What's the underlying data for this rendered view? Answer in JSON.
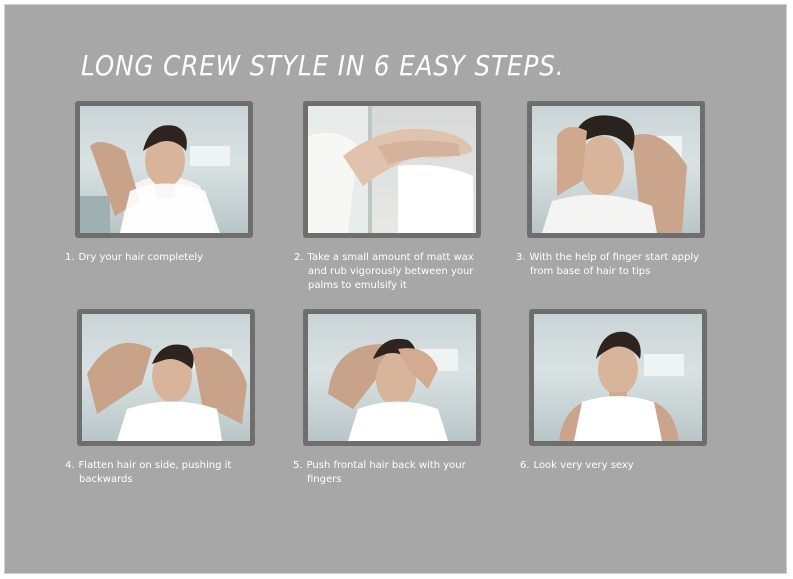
{
  "title": "LONG CREW STYLE IN 6 EASY STEPS.",
  "steps": [
    {
      "num": "1.",
      "line1": "Dry your hair completely",
      "line2": "",
      "line3": ""
    },
    {
      "num": "2.",
      "line1": "Take a small amount of matt wax",
      "line2": "and rub vigorously between your",
      "line3": "palms to emulsify it"
    },
    {
      "num": "3.",
      "line1": "With the help of finger start apply",
      "line2": "from base of hair to tips",
      "line3": ""
    },
    {
      "num": "4.",
      "line1": "Flatten hair on side, pushing it",
      "line2": "backwards",
      "line3": ""
    },
    {
      "num": "5.",
      "line1": "Push frontal hair back with your",
      "line2": "fingers",
      "line3": ""
    },
    {
      "num": "6.",
      "line1": "Look very very sexy",
      "line2": "",
      "line3": ""
    }
  ],
  "colors": {
    "background": "#a7a7a7",
    "frame": "#6e6e6e",
    "text": "#ffffff"
  }
}
